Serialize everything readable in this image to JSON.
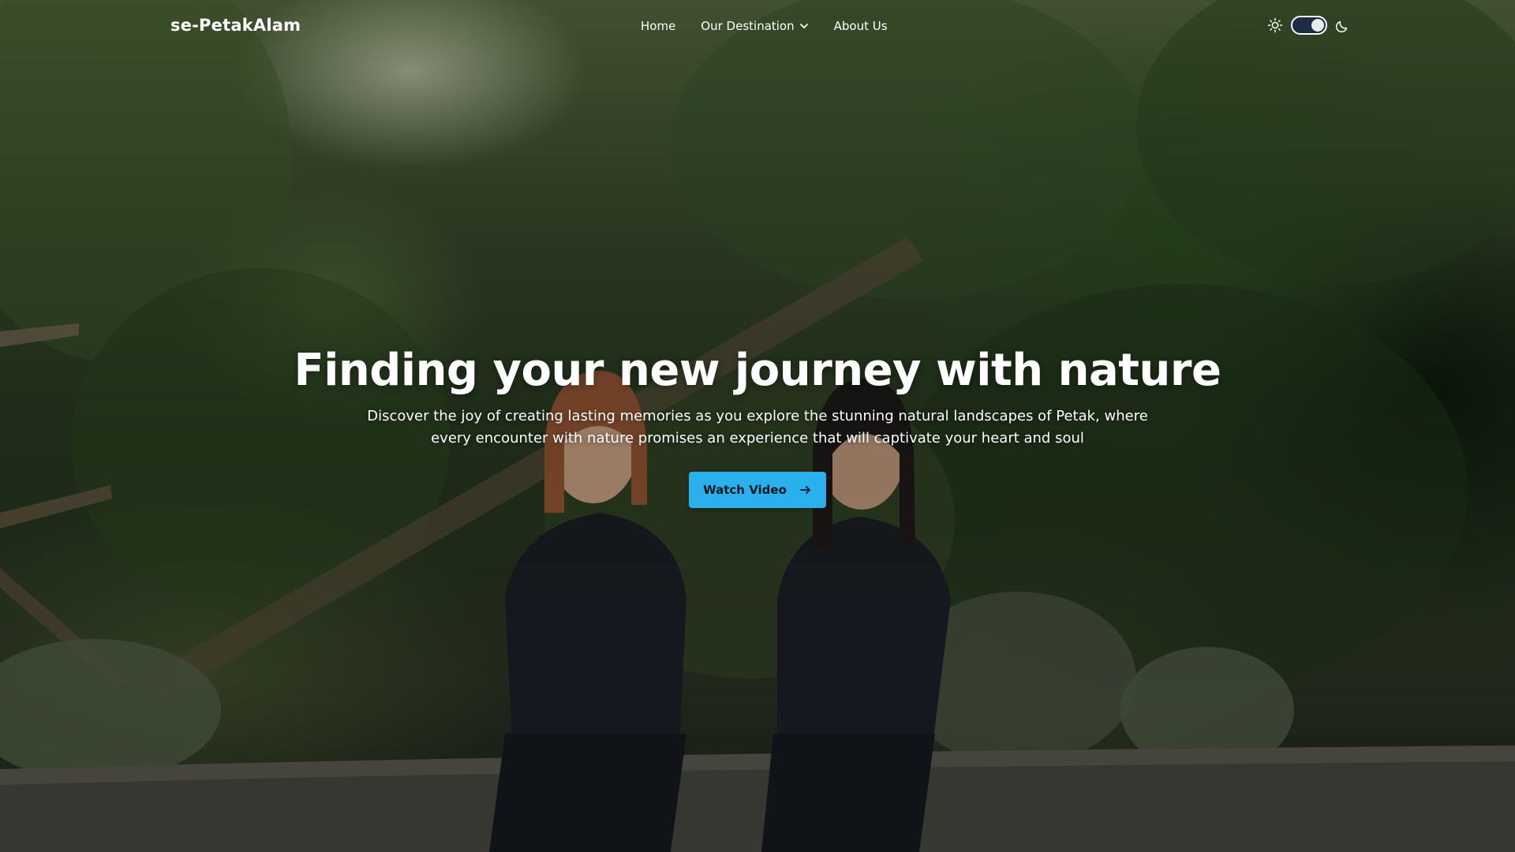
{
  "nav": {
    "brand": "se-PetakAlam",
    "links": [
      {
        "label": "Home"
      },
      {
        "label": "Our Destination",
        "icon": "chevron-down-icon"
      },
      {
        "label": "About Us"
      }
    ],
    "theme_toggle": {
      "left_icon": "sun-icon",
      "right_icon": "moon-icon",
      "state": "dark"
    }
  },
  "hero": {
    "title": "Finding your new journey with nature",
    "subtitle_line1": "Discover the joy of creating lasting memories as you explore the stunning natural landscapes of Petak, where",
    "subtitle_line2": "every encounter with nature promises an experience that will captivate your heart and soul",
    "cta_label": "Watch Video",
    "cta_icon": "arrow-right-icon"
  },
  "colors": {
    "cta_bg": "#2ab0ec",
    "text": "#ffffff",
    "toggle_track": "#1e2b44"
  }
}
